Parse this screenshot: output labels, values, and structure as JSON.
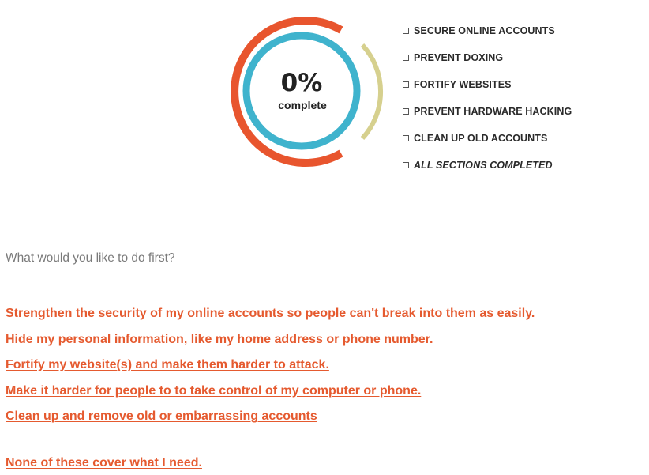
{
  "progress": {
    "percent_label": "0%",
    "complete_label": "complete",
    "value": 0,
    "colors": {
      "outer": "#e8552e",
      "inner": "#3fb3cd",
      "side": "#d6d08e"
    }
  },
  "checklist": [
    {
      "label": "SECURE ONLINE ACCOUNTS",
      "checked": false
    },
    {
      "label": "PREVENT DOXING",
      "checked": false
    },
    {
      "label": "FORTIFY WEBSITES",
      "checked": false
    },
    {
      "label": "PREVENT HARDWARE HACKING",
      "checked": false
    },
    {
      "label": "CLEAN UP OLD ACCOUNTS",
      "checked": false
    },
    {
      "label": "ALL SECTIONS COMPLETED",
      "checked": false
    }
  ],
  "question": "What would you like to do first?",
  "options": [
    "Strengthen the security of my online accounts so people can't break into them as easily.",
    "Hide my personal information, like my home address or phone number.",
    "Fortify my website(s) and make them harder to attack.",
    "Make it harder for people to to take control of my computer or phone.",
    "Clean up and remove old or embarrassing accounts"
  ],
  "none_option": "None of these cover what I need.",
  "link_color": "#e55a2f"
}
